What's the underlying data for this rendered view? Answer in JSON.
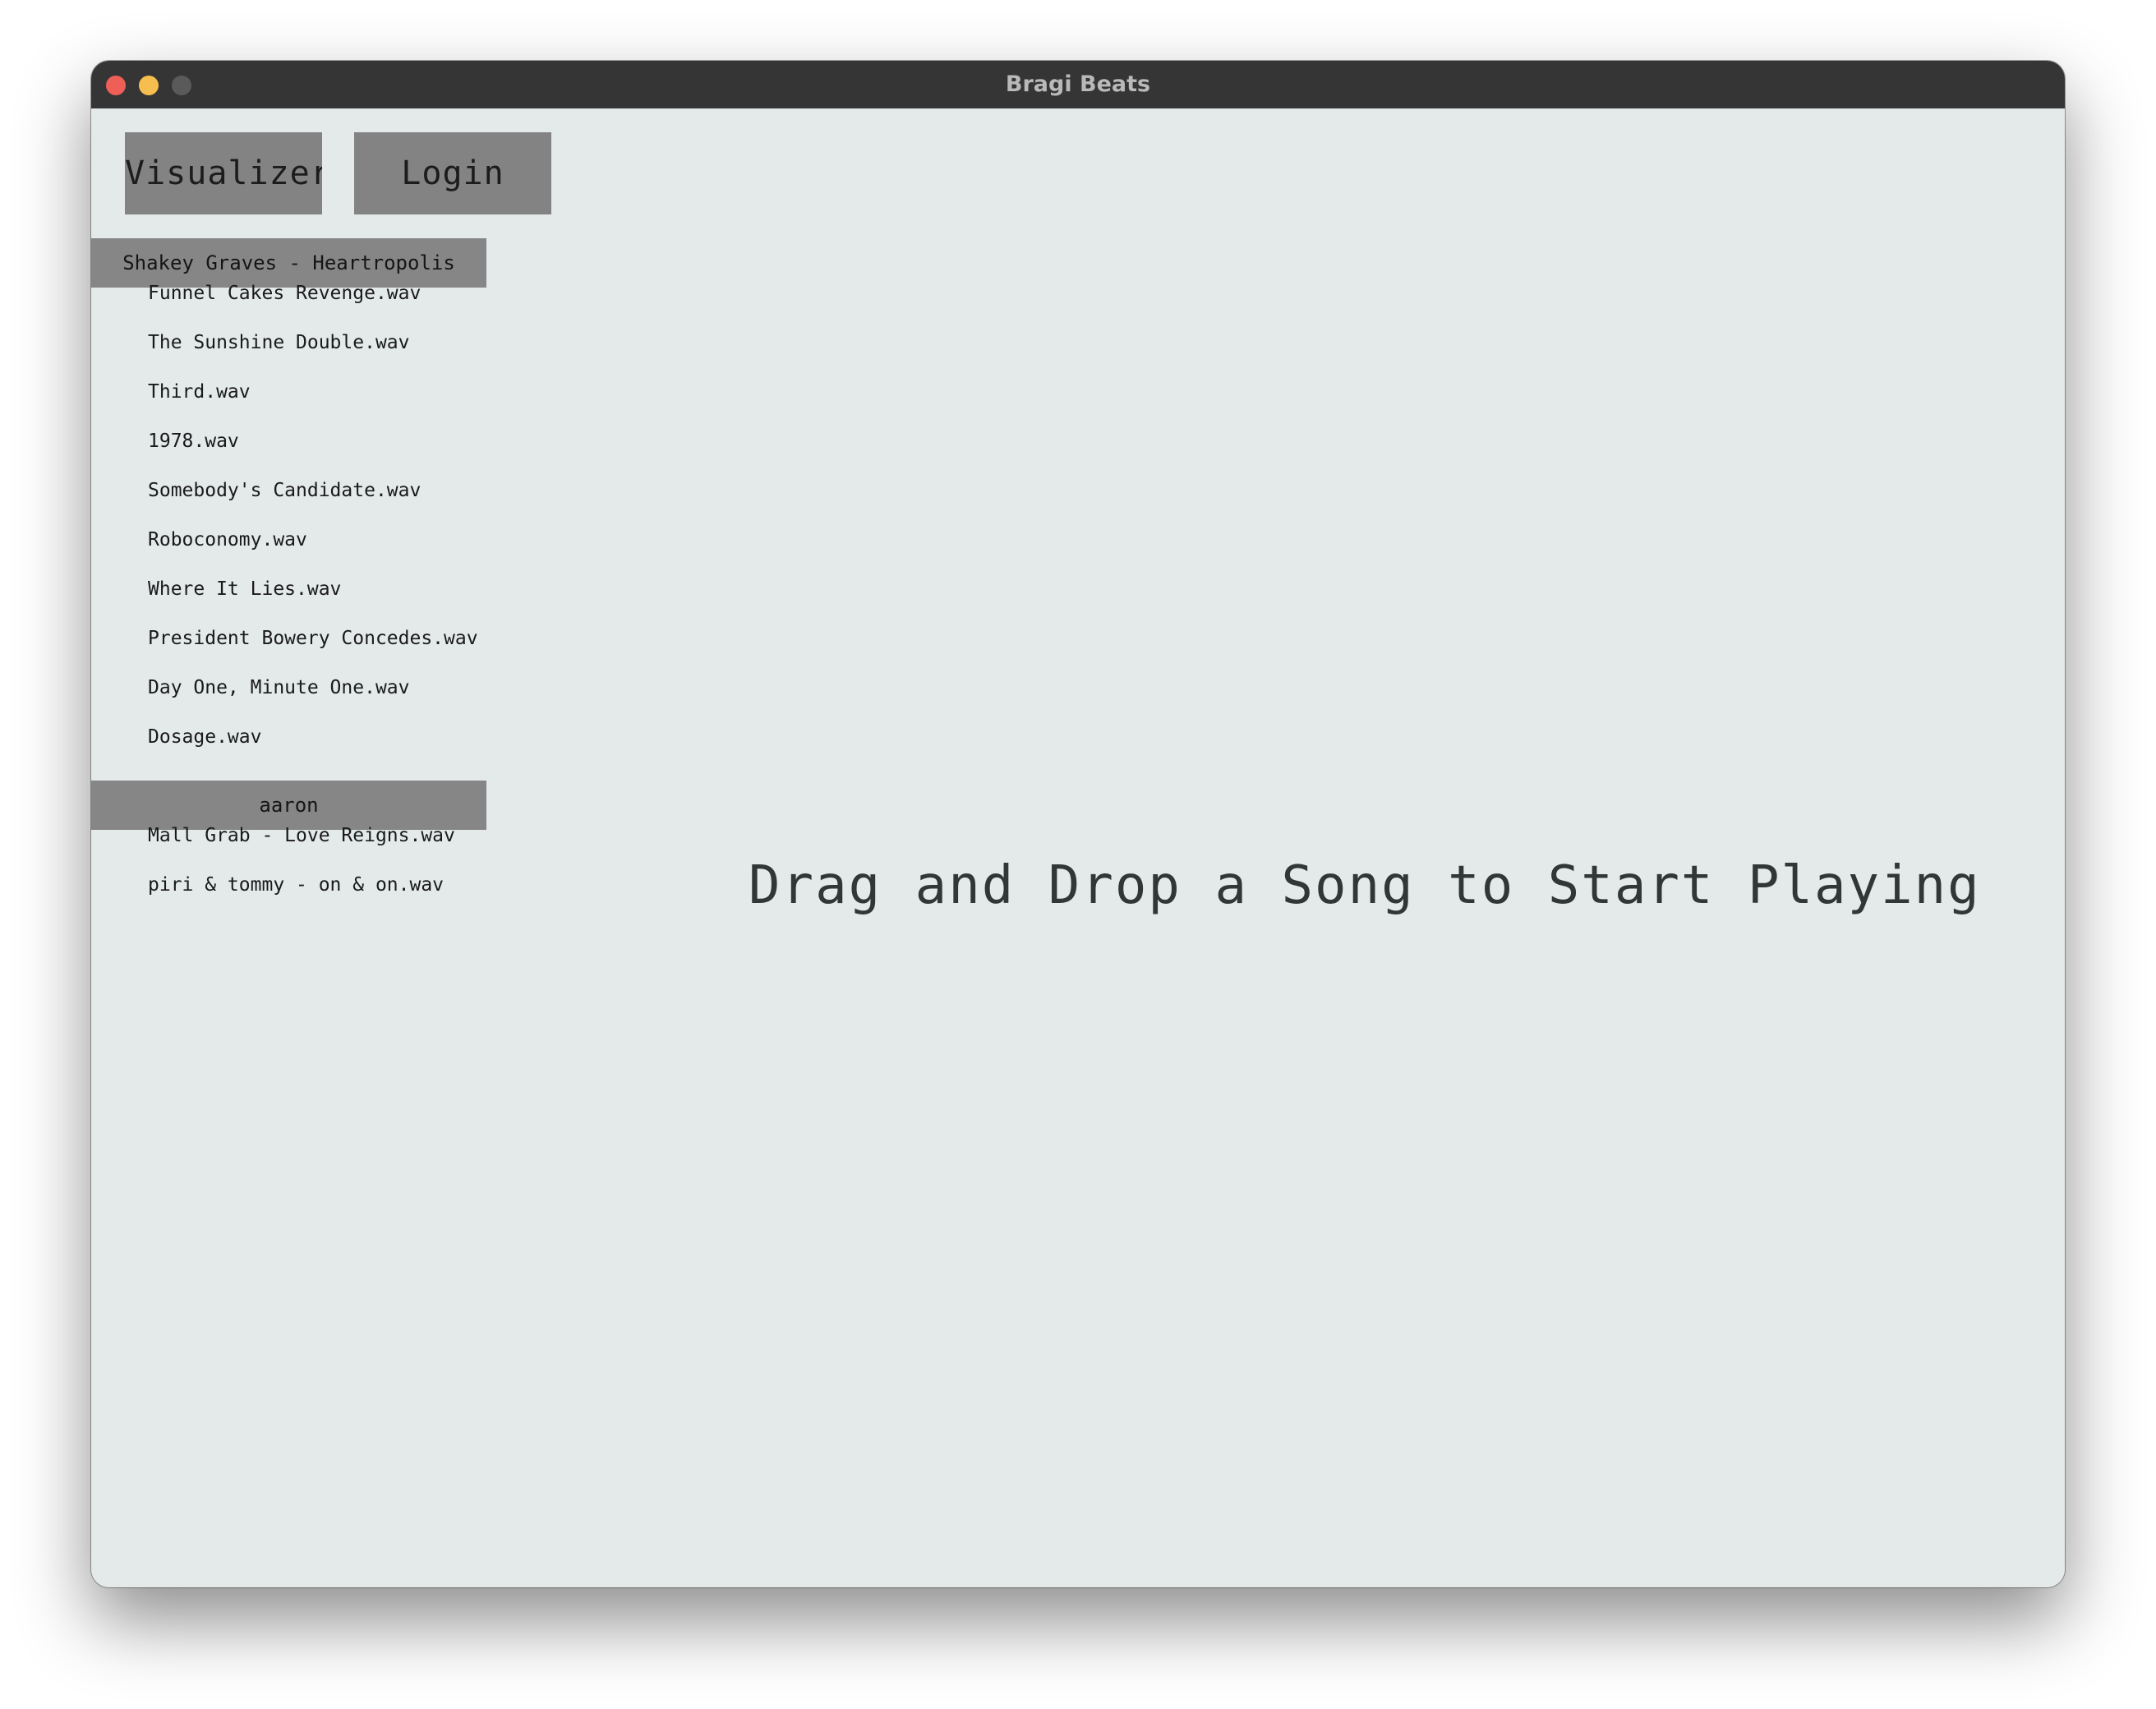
{
  "window": {
    "title": "Bragi Beats"
  },
  "toolbar": {
    "visualizers_label": "Visualizers",
    "login_label": "Login"
  },
  "library": {
    "groups": [
      {
        "name": "Shakey Graves - Heartropolis",
        "tracks": [
          "Funnel Cakes Revenge.wav",
          "The Sunshine Double.wav",
          "Third.wav",
          "1978.wav",
          "Somebody's Candidate.wav",
          "Roboconomy.wav",
          "Where It Lies.wav",
          "President Bowery Concedes.wav",
          "Day One, Minute One.wav",
          "Dosage.wav"
        ]
      },
      {
        "name": "aaron",
        "tracks": [
          "Mall Grab - Love Reigns.wav",
          "piri & tommy - on & on.wav"
        ]
      }
    ]
  },
  "main": {
    "drop_message": "Drag and Drop a Song to Start Playing"
  }
}
